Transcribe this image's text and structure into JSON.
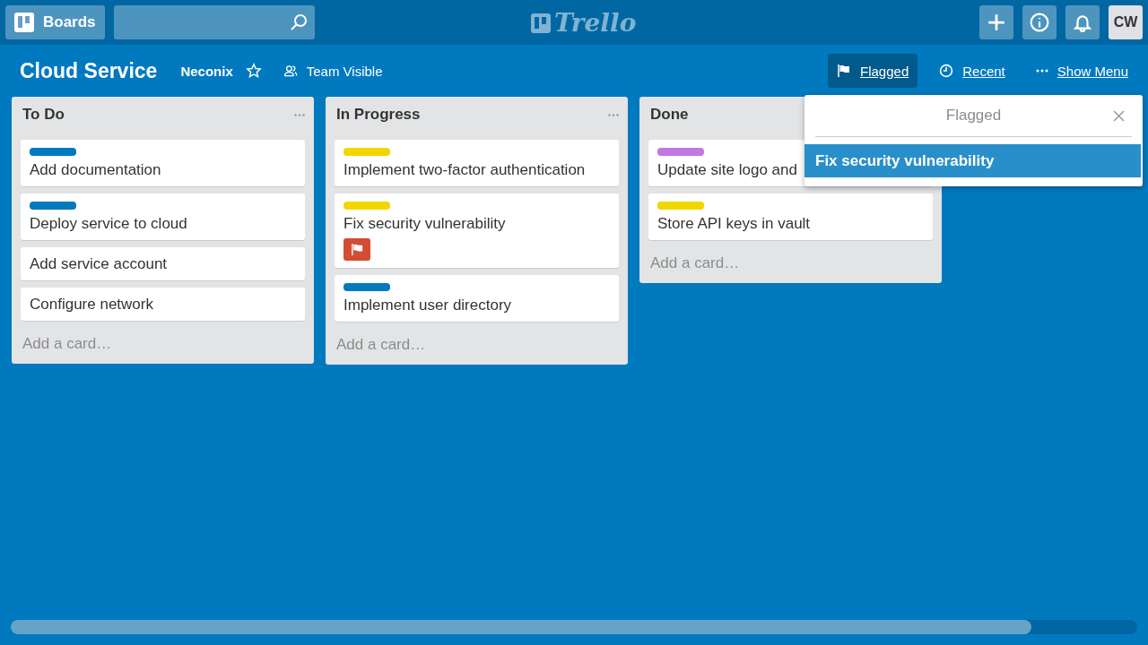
{
  "topbar": {
    "boards_button": "Boards",
    "logo": "Trello",
    "avatar": "CW"
  },
  "board": {
    "title": "Cloud Service",
    "team": "Neconix",
    "starred": false,
    "visibility": "Team Visible",
    "nav": [
      {
        "kind": "flag",
        "label": "Flagged",
        "selected": true
      },
      {
        "kind": "clock",
        "label": "Recent",
        "selected": false
      },
      {
        "kind": "dots",
        "label": "Show Menu",
        "selected": false
      }
    ]
  },
  "lists": [
    {
      "title": "To Do",
      "add_card": "Add a card…",
      "cards": [
        {
          "color": "#0079bf",
          "title": "Add documentation",
          "flagged": false
        },
        {
          "color": "#0079bf",
          "title": "Deploy service to cloud",
          "flagged": false
        },
        {
          "title": "Add service account",
          "flagged": false
        },
        {
          "title": "Configure network",
          "flagged": false
        }
      ]
    },
    {
      "title": "In Progress",
      "add_card": "Add a card…",
      "cards": [
        {
          "color": "#f2d600",
          "title": "Implement two-factor authentication",
          "flagged": false
        },
        {
          "color": "#f2d600",
          "title": "Fix security vulnerability",
          "flagged": true
        },
        {
          "color": "#0079bf",
          "title": "Implement user directory",
          "flagged": false
        }
      ]
    },
    {
      "title": "Done",
      "add_card": "Add a card…",
      "cards": [
        {
          "color": "#c377e0",
          "title": "Update site logo and",
          "flagged": false
        },
        {
          "color": "#f2d600",
          "title": "Store API keys in vault",
          "flagged": false
        }
      ]
    }
  ],
  "popover": {
    "title": "Flagged",
    "items": [
      {
        "title": "Fix security vulnerability",
        "selected": true
      }
    ]
  }
}
